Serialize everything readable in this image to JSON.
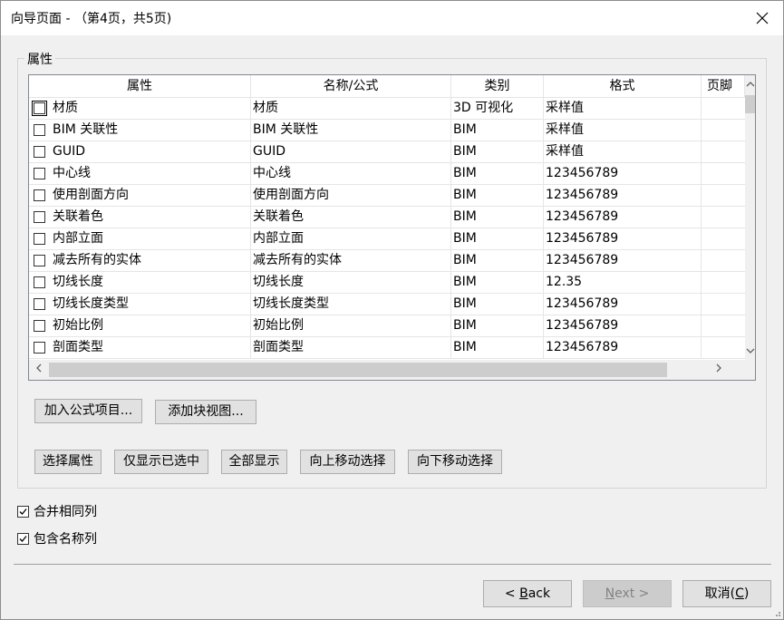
{
  "window": {
    "title": "向导页面 - （第4页，共5页)"
  },
  "group": {
    "legend": "属性"
  },
  "grid": {
    "columns": [
      "属性",
      "名称/公式",
      "类别",
      "格式",
      "页脚"
    ],
    "rows": [
      {
        "attr": "材质",
        "name": "材质",
        "category": "3D 可视化",
        "format": "采样值",
        "footer": ""
      },
      {
        "attr": "BIM 关联性",
        "name": "BIM 关联性",
        "category": "BIM",
        "format": "采样值",
        "footer": ""
      },
      {
        "attr": "GUID",
        "name": "GUID",
        "category": "BIM",
        "format": "采样值",
        "footer": ""
      },
      {
        "attr": "中心线",
        "name": "中心线",
        "category": "BIM",
        "format": "123456789",
        "footer": ""
      },
      {
        "attr": "使用剖面方向",
        "name": "使用剖面方向",
        "category": "BIM",
        "format": "123456789",
        "footer": ""
      },
      {
        "attr": "关联着色",
        "name": "关联着色",
        "category": "BIM",
        "format": "123456789",
        "footer": ""
      },
      {
        "attr": "内部立面",
        "name": "内部立面",
        "category": "BIM",
        "format": "123456789",
        "footer": ""
      },
      {
        "attr": "减去所有的实体",
        "name": "减去所有的实体",
        "category": "BIM",
        "format": "123456789",
        "footer": ""
      },
      {
        "attr": "切线长度",
        "name": "切线长度",
        "category": "BIM",
        "format": "12.35",
        "footer": ""
      },
      {
        "attr": "切线长度类型",
        "name": "切线长度类型",
        "category": "BIM",
        "format": "123456789",
        "footer": ""
      },
      {
        "attr": "初始比例",
        "name": "初始比例",
        "category": "BIM",
        "format": "123456789",
        "footer": ""
      },
      {
        "attr": "剖面类型",
        "name": "剖面类型",
        "category": "BIM",
        "format": "123456789",
        "footer": ""
      }
    ]
  },
  "buttons": {
    "add_formula": "加入公式项目...",
    "add_block_view": "添加块视图...",
    "select_attr": "选择属性",
    "show_selected": "仅显示已选中",
    "show_all": "全部显示",
    "move_up": "向上移动选择",
    "move_down": "向下移动选择"
  },
  "options": {
    "merge_same_columns": "合并相同列",
    "include_name_column": "包含名称列"
  },
  "footer": {
    "back_prefix": "< ",
    "back_key": "B",
    "back_rest": "ack",
    "next_prefix": "",
    "next_key": "N",
    "next_rest": "ext >",
    "cancel_prefix": "取消(",
    "cancel_key": "C",
    "cancel_suffix": ")"
  }
}
